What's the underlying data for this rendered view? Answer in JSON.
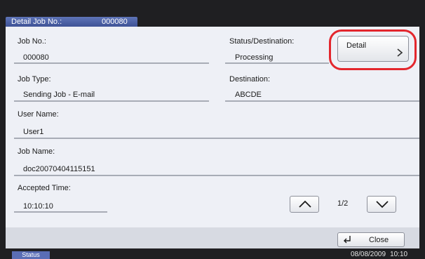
{
  "header": {
    "label": "Detail Job No.:",
    "job_no": "000080"
  },
  "fields": {
    "job_no": {
      "label": "Job No.:",
      "value": "000080"
    },
    "status": {
      "label": "Status/Destination:",
      "value": "Processing"
    },
    "job_type": {
      "label": "Job Type:",
      "value": "Sending Job - E-mail"
    },
    "destination": {
      "label": "Destination:",
      "value": "ABCDE"
    },
    "user_name": {
      "label": "User Name:",
      "value": "User1"
    },
    "job_name": {
      "label": "Job Name:",
      "value": "doc20070404115151"
    },
    "accepted_time": {
      "label": "Accepted Time:",
      "value": "10:10:10"
    }
  },
  "detail_button": {
    "label": "Detail",
    "icon": "chevron-right-icon"
  },
  "paging": {
    "indicator": "1/2",
    "up_icon": "arrow-up-icon",
    "down_icon": "arrow-down-icon"
  },
  "close_button": {
    "label": "Close",
    "icon": "return-arrow-icon"
  },
  "status_bar": {
    "status_label": "Status",
    "date": "08/08/2009",
    "time": "10:10"
  },
  "colors": {
    "title_bar": "#4a5ea6",
    "highlight": "#e3262d",
    "panel": "#eef0f6",
    "frame": "#1f1f22"
  }
}
